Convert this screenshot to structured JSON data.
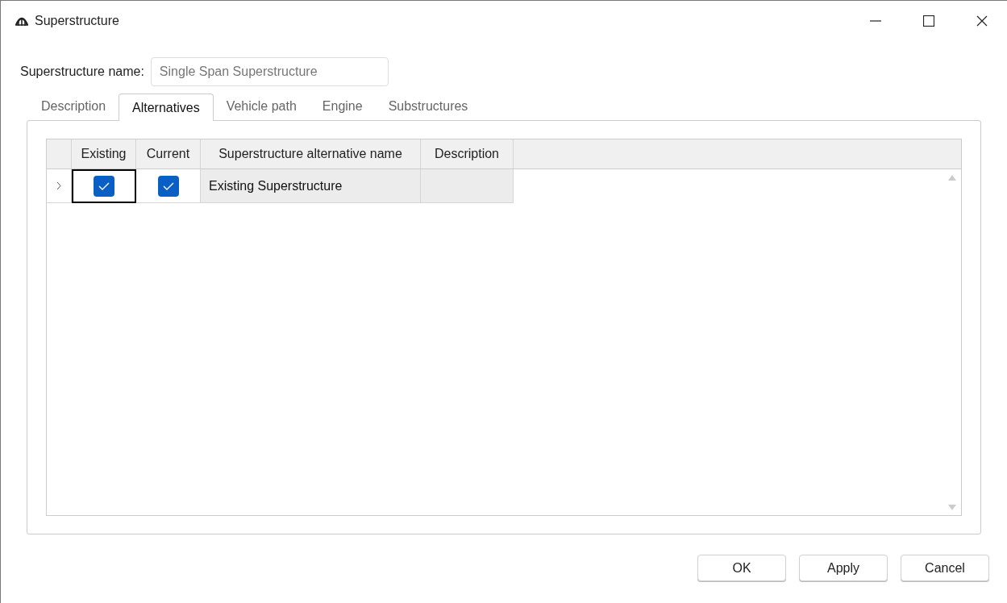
{
  "window": {
    "title": "Superstructure"
  },
  "name_field": {
    "label": "Superstructure name:",
    "value": "Single Span Superstructure",
    "disabled": true
  },
  "tabs": [
    {
      "label": "Description",
      "selected": false
    },
    {
      "label": "Alternatives",
      "selected": true
    },
    {
      "label": "Vehicle path",
      "selected": false
    },
    {
      "label": "Engine",
      "selected": false
    },
    {
      "label": "Substructures",
      "selected": false
    }
  ],
  "table": {
    "columns": [
      "Existing",
      "Current",
      "Superstructure alternative name",
      "Description"
    ],
    "rows": [
      {
        "expanded": false,
        "cells": [
          {
            "kind": "checkbox",
            "checked": true,
            "focused": true
          },
          {
            "kind": "checkbox",
            "checked": true,
            "focused": false
          },
          {
            "kind": "text",
            "text": "Existing Superstructure",
            "focused": false
          },
          {
            "kind": "empty",
            "focused": false
          }
        ]
      }
    ]
  },
  "buttons": [
    "OK",
    "Apply",
    "Cancel"
  ]
}
